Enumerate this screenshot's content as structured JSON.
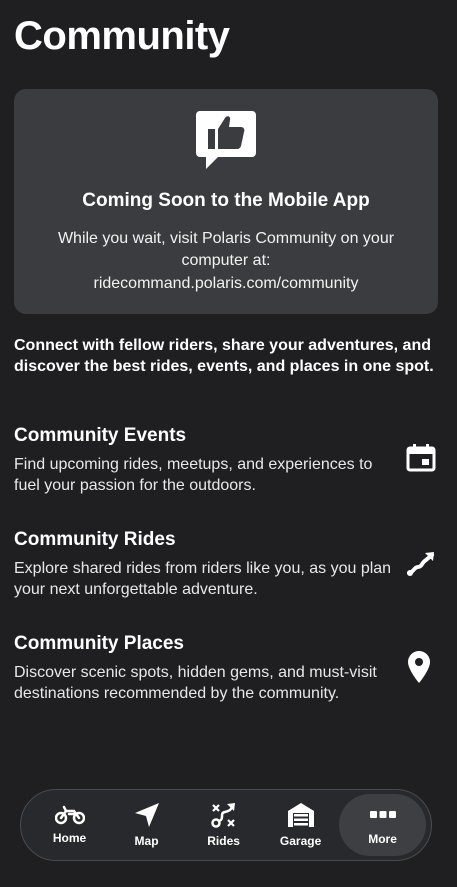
{
  "header": {
    "title": "Community"
  },
  "card": {
    "icon": "thumbs-up-speech-icon",
    "title": "Coming Soon to the Mobile App",
    "body": "While you wait, visit Polaris Community on your computer at:",
    "link": "ridecommand.polaris.com/community"
  },
  "intro": "Connect with fellow riders, share your adventures, and discover the best rides, events, and places in one spot.",
  "sections": [
    {
      "title": "Community Events",
      "body": "Find upcoming rides, meetups, and experiences to fuel your passion for the outdoors.",
      "icon": "calendar-icon"
    },
    {
      "title": "Community Rides",
      "body": "Explore shared rides from riders like you, as you plan your next unforgettable adventure.",
      "icon": "route-icon"
    },
    {
      "title": "Community Places",
      "body": "Discover scenic spots, hidden gems, and must-visit destinations recommended by the community.",
      "icon": "location-pin-icon"
    }
  ],
  "nav": {
    "items": [
      {
        "label": "Home",
        "icon": "vehicle-icon",
        "active": false
      },
      {
        "label": "Map",
        "icon": "navigation-arrow-icon",
        "active": false
      },
      {
        "label": "Rides",
        "icon": "rides-icon",
        "active": false
      },
      {
        "label": "Garage",
        "icon": "garage-icon",
        "active": false
      },
      {
        "label": "More",
        "icon": "more-icon",
        "active": true
      }
    ]
  }
}
